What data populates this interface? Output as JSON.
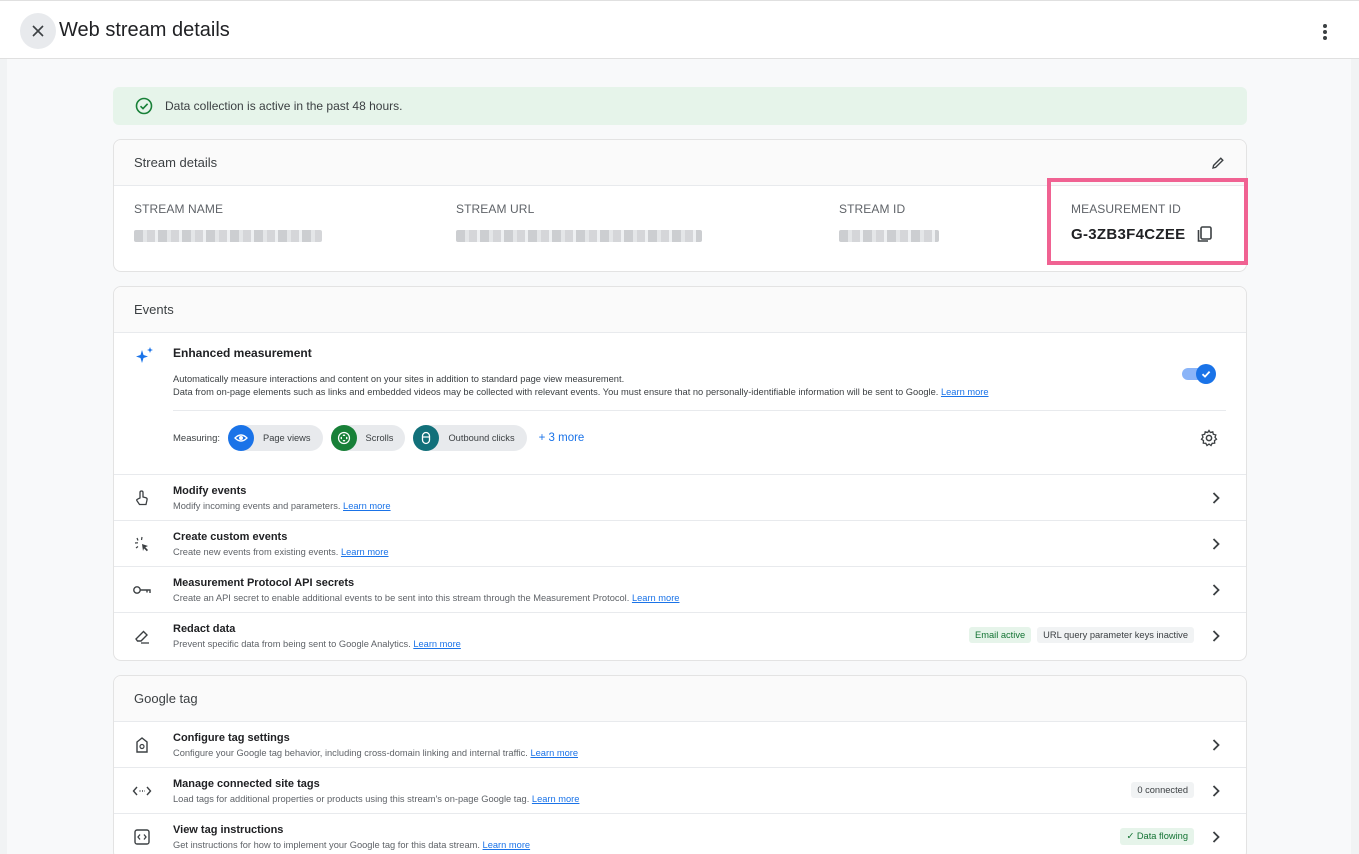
{
  "header": {
    "title": "Web stream details"
  },
  "banner": {
    "text": "Data collection is active in the past 48 hours."
  },
  "stream_details": {
    "title": "Stream details",
    "fields": [
      {
        "label": "STREAM NAME"
      },
      {
        "label": "STREAM URL"
      },
      {
        "label": "STREAM ID"
      }
    ],
    "measurement_id": {
      "label": "MEASUREMENT ID",
      "value": "G-3ZB3F4CZEE"
    }
  },
  "events": {
    "title": "Events",
    "enhanced": {
      "title": "Enhanced measurement",
      "desc_line1": "Automatically measure interactions and content on your sites in addition to standard page view measurement.",
      "desc_line2": "Data from on-page elements such as links and embedded videos may be collected with relevant events. You must ensure that no personally-identifiable information will be sent to Google.",
      "learn_more": "Learn more",
      "toggle_on": true,
      "measuring_label": "Measuring:",
      "chips": [
        {
          "label": "Page views",
          "color": "#1a73e8",
          "icon": "eye-icon"
        },
        {
          "label": "Scrolls",
          "color": "#188038",
          "icon": "scroll-icon"
        },
        {
          "label": "Outbound clicks",
          "color": "#12707a",
          "icon": "mouse-icon"
        }
      ],
      "more": "+ 3 more"
    },
    "rows": [
      {
        "title": "Modify events",
        "subtitle": "Modify incoming events and parameters.",
        "link": "Learn more",
        "icon": "touch-icon"
      },
      {
        "title": "Create custom events",
        "subtitle": "Create new events from existing events.",
        "link": "Learn more",
        "icon": "sparkle-click-icon"
      },
      {
        "title": "Measurement Protocol API secrets",
        "subtitle": "Create an API secret to enable additional events to be sent into this stream through the Measurement Protocol.",
        "link": "Learn more",
        "icon": "key-icon"
      },
      {
        "title": "Redact data",
        "subtitle": "Prevent specific data from being sent to Google Analytics.",
        "link": "Learn more",
        "icon": "eraser-icon",
        "badge_green": "Email active",
        "badge_grey": "URL query parameter keys inactive"
      }
    ]
  },
  "google_tag": {
    "title": "Google tag",
    "rows": [
      {
        "title": "Configure tag settings",
        "subtitle": "Configure your Google tag behavior, including cross-domain linking and internal traffic.",
        "link": "Learn more",
        "icon": "tag-icon"
      },
      {
        "title": "Manage connected site tags",
        "subtitle": "Load tags for additional properties or products using this stream's on-page Google tag.",
        "link": "Learn more",
        "icon": "code-arrows-icon",
        "badge_grey": "0 connected"
      },
      {
        "title": "View tag instructions",
        "subtitle": "Get instructions for how to implement your Google tag for this data stream.",
        "link": "Learn more",
        "icon": "code-box-icon",
        "badge_green": "✓ Data flowing"
      }
    ]
  },
  "colors": {
    "accent": "#1a73e8",
    "highlight": "#f06292",
    "banner_bg": "#e6f4ea",
    "success": "#188038"
  }
}
